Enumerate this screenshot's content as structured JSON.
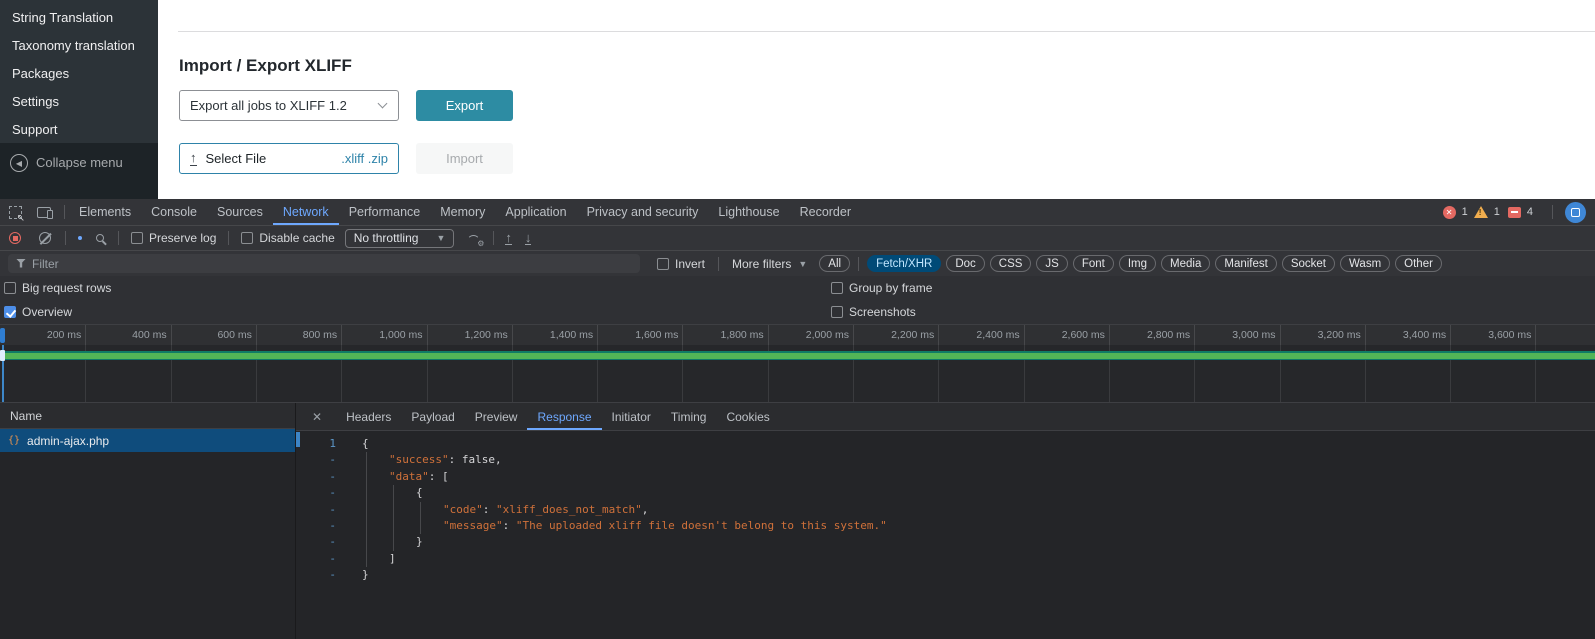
{
  "wp": {
    "sidebar": {
      "items": [
        "String Translation",
        "Taxonomy translation",
        "Packages",
        "Settings",
        "Support"
      ],
      "collapse_label": "Collapse menu"
    },
    "page": {
      "title": "Import / Export XLIFF",
      "export_select_value": "Export all jobs to XLIFF 1.2",
      "export_button": "Export",
      "select_file_label": "Select File",
      "select_file_ext": ".xliff .zip",
      "import_button": "Import"
    }
  },
  "devtools": {
    "tabs": [
      "Elements",
      "Console",
      "Sources",
      "Network",
      "Performance",
      "Memory",
      "Application",
      "Privacy and security",
      "Lighthouse",
      "Recorder"
    ],
    "active_tab": "Network",
    "badges": {
      "errors": "1",
      "warnings": "1",
      "issues": "4"
    },
    "network_toolbar": {
      "preserve_log": "Preserve log",
      "disable_cache": "Disable cache",
      "throttling": "No throttling"
    },
    "filter_bar": {
      "placeholder": "Filter",
      "invert": "Invert",
      "more_filters": "More filters",
      "pills": [
        "All",
        "Fetch/XHR",
        "Doc",
        "CSS",
        "JS",
        "Font",
        "Img",
        "Media",
        "Manifest",
        "Socket",
        "Wasm",
        "Other"
      ],
      "active_pill": "Fetch/XHR"
    },
    "options": {
      "big_request_rows": "Big request rows",
      "group_by_frame": "Group by frame",
      "overview": "Overview",
      "screenshots": "Screenshots",
      "overview_checked": true
    },
    "ruler_labels": [
      "200 ms",
      "400 ms",
      "600 ms",
      "800 ms",
      "1,000 ms",
      "1,200 ms",
      "1,400 ms",
      "1,600 ms",
      "1,800 ms",
      "2,000 ms",
      "2,200 ms",
      "2,400 ms",
      "2,600 ms",
      "2,800 ms",
      "3,000 ms",
      "3,200 ms",
      "3,400 ms",
      "3,600 ms"
    ],
    "requests": {
      "name_header": "Name",
      "rows": [
        {
          "name": "admin-ajax.php",
          "selected": true
        }
      ]
    },
    "detail_tabs": [
      "Headers",
      "Payload",
      "Preview",
      "Response",
      "Initiator",
      "Timing",
      "Cookies"
    ],
    "active_detail_tab": "Response",
    "close_glyph": "✕",
    "upload_glyph": "↑",
    "response_lines": [
      {
        "gutter": "1",
        "indent": 0,
        "tokens": [
          {
            "t": "{",
            "c": "p"
          }
        ]
      },
      {
        "gutter": "-",
        "indent": 1,
        "tokens": [
          {
            "t": "\"success\"",
            "c": "k"
          },
          {
            "t": ": ",
            "c": "p"
          },
          {
            "t": "false",
            "c": "v"
          },
          {
            "t": ",",
            "c": "p"
          }
        ]
      },
      {
        "gutter": "-",
        "indent": 1,
        "tokens": [
          {
            "t": "\"data\"",
            "c": "k"
          },
          {
            "t": ": [",
            "c": "p"
          }
        ]
      },
      {
        "gutter": "-",
        "indent": 2,
        "tokens": [
          {
            "t": "{",
            "c": "p"
          }
        ]
      },
      {
        "gutter": "-",
        "indent": 3,
        "tokens": [
          {
            "t": "\"code\"",
            "c": "k"
          },
          {
            "t": ": ",
            "c": "p"
          },
          {
            "t": "\"xliff_does_not_match\"",
            "c": "s"
          },
          {
            "t": ",",
            "c": "p"
          }
        ]
      },
      {
        "gutter": "-",
        "indent": 3,
        "tokens": [
          {
            "t": "\"message\"",
            "c": "k"
          },
          {
            "t": ": ",
            "c": "p"
          },
          {
            "t": "\"The uploaded xliff file doesn't belong to this system.\"",
            "c": "s"
          }
        ]
      },
      {
        "gutter": "-",
        "indent": 2,
        "tokens": [
          {
            "t": "}",
            "c": "p"
          }
        ]
      },
      {
        "gutter": "-",
        "indent": 1,
        "tokens": [
          {
            "t": "]",
            "c": "p"
          }
        ]
      },
      {
        "gutter": "-",
        "indent": 0,
        "tokens": [
          {
            "t": "}",
            "c": "p"
          }
        ]
      }
    ],
    "colors": {
      "accent_blue": "#6ea8fe",
      "export_button_teal": "#2d8ca3",
      "file_accent_teal": "#2e83a9",
      "selected_row_blue": "#0f4c7c",
      "active_pill_bg": "#004a77",
      "active_pill_text": "#c2e7ff",
      "overview_green_bar": "#52b457",
      "token_orange": "#d0713a",
      "error_red": "#e46962",
      "warning_yellow": "#f0ad4e"
    }
  }
}
